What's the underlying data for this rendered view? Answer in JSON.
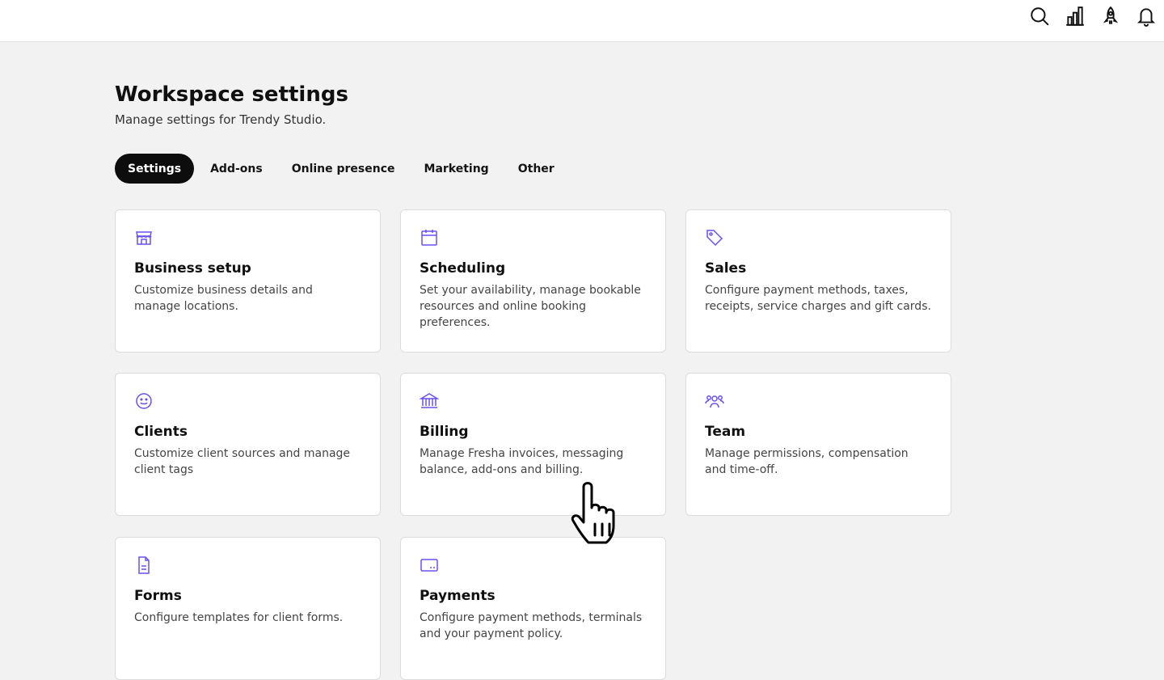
{
  "topbar": {
    "icons": [
      "search-icon",
      "analytics-icon",
      "rocket-icon",
      "bell-icon"
    ]
  },
  "header": {
    "title": "Workspace settings",
    "subtitle": "Manage settings for Trendy Studio."
  },
  "tabs": [
    {
      "label": "Settings",
      "active": true
    },
    {
      "label": "Add-ons",
      "active": false
    },
    {
      "label": "Online presence",
      "active": false
    },
    {
      "label": "Marketing",
      "active": false
    },
    {
      "label": "Other",
      "active": false
    }
  ],
  "cards": [
    {
      "icon": "store-icon",
      "title": "Business setup",
      "description": "Customize business details and manage locations."
    },
    {
      "icon": "calendar-icon",
      "title": "Scheduling",
      "description": "Set your availability, manage bookable resources and online booking preferences."
    },
    {
      "icon": "tag-icon",
      "title": "Sales",
      "description": "Configure payment methods, taxes, receipts, service charges and gift cards."
    },
    {
      "icon": "smiley-icon",
      "title": "Clients",
      "description": "Customize client sources and manage client tags"
    },
    {
      "icon": "bank-icon",
      "title": "Billing",
      "description": "Manage Fresha invoices, messaging balance, add-ons and billing."
    },
    {
      "icon": "team-icon",
      "title": "Team",
      "description": "Manage permissions, compensation and time-off."
    },
    {
      "icon": "document-icon",
      "title": "Forms",
      "description": "Configure templates for client forms."
    },
    {
      "icon": "card-icon",
      "title": "Payments",
      "description": "Configure payment methods, terminals and your payment policy."
    }
  ],
  "colors": {
    "accent_icon": "#6950f3",
    "active_tab_bg": "#0d0d0d",
    "page_bg": "#f2f2f2"
  }
}
